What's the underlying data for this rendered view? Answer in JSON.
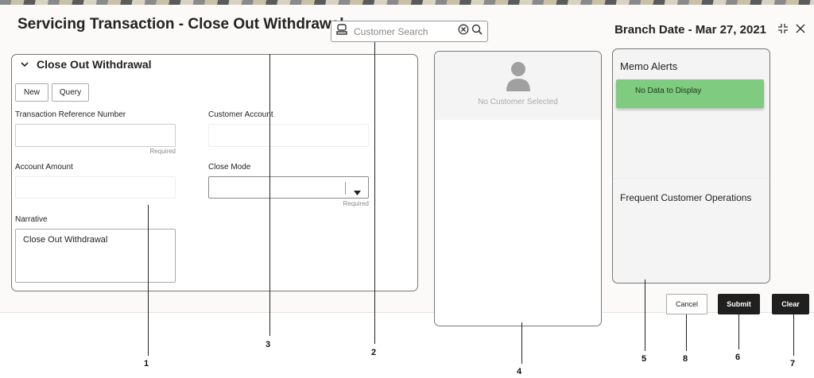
{
  "header": {
    "title": "Servicing Transaction - Close Out Withdrawal",
    "search_placeholder": "Customer Search",
    "branch_date": "Branch Date - Mar 27, 2021"
  },
  "form": {
    "section_title": "Close Out Withdrawal",
    "new_label": "New",
    "query_label": "Query",
    "txn_ref_label": "Transaction Reference Number",
    "txn_ref_value": "",
    "txn_ref_required": "Required",
    "customer_account_label": "Customer Account",
    "customer_account_value": "",
    "account_amount_label": "Account Amount",
    "account_amount_value": "",
    "close_mode_label": "Close Mode",
    "close_mode_value": "",
    "close_mode_required": "Required",
    "narrative_label": "Narrative",
    "narrative_value": "Close Out Withdrawal"
  },
  "customer_panel": {
    "status": "No Customer Selected"
  },
  "side_panel": {
    "memo_alerts_title": "Memo Alerts",
    "memo_alerts_message": "No Data to Display",
    "frequent_ops_title": "Frequent Customer Operations"
  },
  "footer": {
    "cancel_label": "Cancel",
    "submit_label": "Submit",
    "clear_label": "Clear"
  },
  "callouts": [
    "1",
    "2",
    "3",
    "4",
    "5",
    "6",
    "7",
    "8"
  ],
  "colors": {
    "memo_green": "#7fcb7f",
    "primary_button": "#1f1f1f"
  }
}
